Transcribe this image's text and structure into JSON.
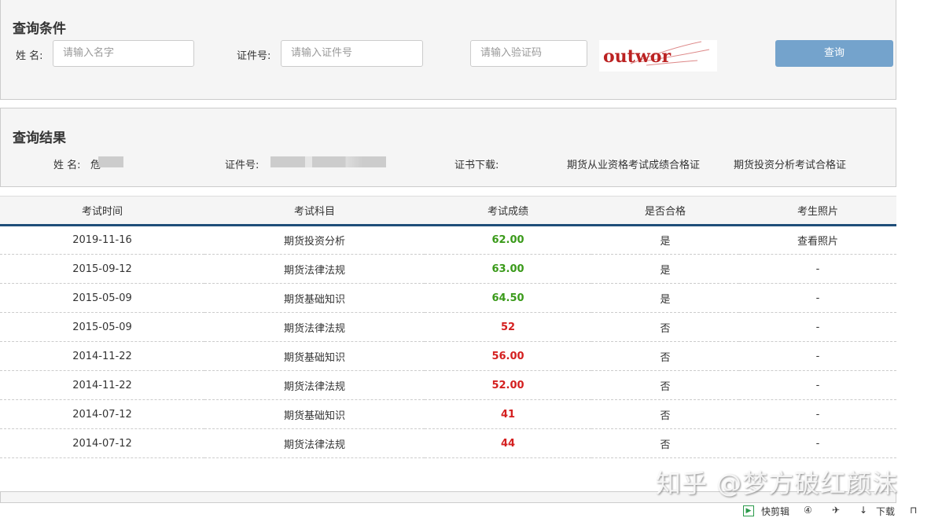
{
  "query": {
    "title": "查询条件",
    "name_label": "姓 名:",
    "name_placeholder": "请输入名字",
    "id_label": "证件号:",
    "id_placeholder": "请输入证件号",
    "captcha_placeholder": "请输入验证码",
    "captcha_text": "outwor",
    "submit": "查询"
  },
  "result": {
    "title": "查询结果",
    "name_label": "姓 名:",
    "name_value": "危",
    "id_label": "证件号:",
    "cert_label": "证书下载:",
    "cert1": "期货从业资格考试成绩合格证",
    "cert2": "期货投资分析考试合格证"
  },
  "table": {
    "headers": [
      "考试时间",
      "考试科目",
      "考试成绩",
      "是否合格",
      "考生照片"
    ],
    "rows": [
      {
        "date": "2019-11-16",
        "subject": "期货投资分析",
        "score": "62.00",
        "pass": "是",
        "photo": "查看照片",
        "ok": true
      },
      {
        "date": "2015-09-12",
        "subject": "期货法律法规",
        "score": "63.00",
        "pass": "是",
        "photo": "-",
        "ok": true
      },
      {
        "date": "2015-05-09",
        "subject": "期货基础知识",
        "score": "64.50",
        "pass": "是",
        "photo": "-",
        "ok": true
      },
      {
        "date": "2015-05-09",
        "subject": "期货法律法规",
        "score": "52",
        "pass": "否",
        "photo": "-",
        "ok": false
      },
      {
        "date": "2014-11-22",
        "subject": "期货基础知识",
        "score": "56.00",
        "pass": "否",
        "photo": "-",
        "ok": false
      },
      {
        "date": "2014-11-22",
        "subject": "期货法律法规",
        "score": "52.00",
        "pass": "否",
        "photo": "-",
        "ok": false
      },
      {
        "date": "2014-07-12",
        "subject": "期货基础知识",
        "score": "41",
        "pass": "否",
        "photo": "-",
        "ok": false
      },
      {
        "date": "2014-07-12",
        "subject": "期货法律法规",
        "score": "44",
        "pass": "否",
        "photo": "-",
        "ok": false
      }
    ]
  },
  "watermark": "知乎 @梦方破红颜沫",
  "statusbar": {
    "clip": "快剪辑",
    "download": "下载"
  },
  "colors": {
    "pass": "#3a9a1a",
    "fail": "#d42020",
    "accent": "#1f4e79",
    "button": "#74a3cc"
  }
}
